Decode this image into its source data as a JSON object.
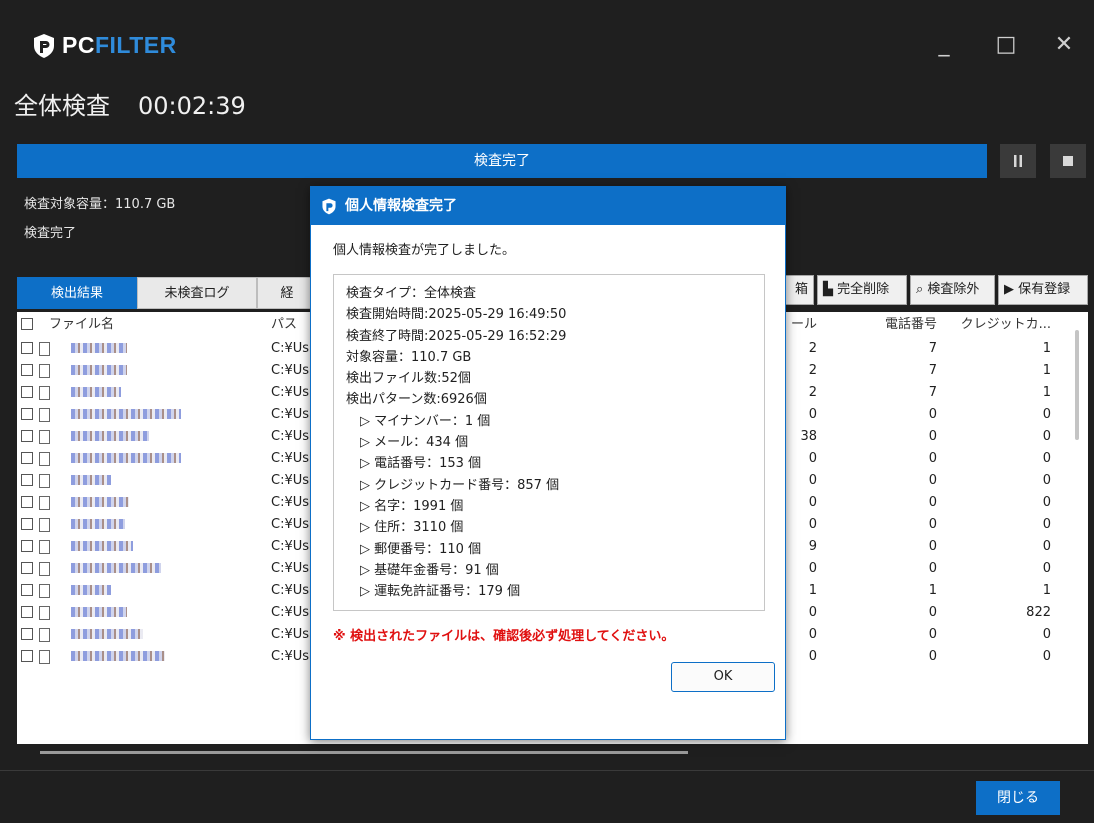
{
  "app": {
    "logo_pc": "PC",
    "logo_filter": "FILTER",
    "window_controls": {
      "minimize": "_",
      "maximize": "□",
      "close": "✕"
    }
  },
  "page": {
    "title": "全体検査",
    "elapsed": "00:02:39"
  },
  "progress": {
    "label": "検査完了",
    "percent": 100,
    "pause_icon": "pause-icon",
    "stop_icon": "stop-icon"
  },
  "info": {
    "capacity": "検査対象容量：110.7 GB",
    "status": "検査完了"
  },
  "tabs": [
    {
      "label": "検出結果",
      "active": true
    },
    {
      "label": "未検査ログ",
      "active": false
    },
    {
      "label": "経",
      "active": false
    }
  ],
  "toolbar": {
    "partial_label": "箱",
    "delete_label": "完全削除",
    "exclude_label": "検査除外",
    "register_label": "保有登録"
  },
  "table": {
    "headers": {
      "name": "ファイル名",
      "path": "パス",
      "mail": "ール",
      "phone": "電話番号",
      "credit": "クレジットカ..."
    },
    "rows": [
      {
        "path": "C:¥Us",
        "mail": "2",
        "phone": "7",
        "credit": "1"
      },
      {
        "path": "C:¥Us",
        "mail": "2",
        "phone": "7",
        "credit": "1"
      },
      {
        "path": "C:¥Us",
        "mail": "2",
        "phone": "7",
        "credit": "1"
      },
      {
        "path": "C:¥Us",
        "mail": "0",
        "phone": "0",
        "credit": "0"
      },
      {
        "path": "C:¥Us",
        "mail": "38",
        "phone": "0",
        "credit": "0"
      },
      {
        "path": "C:¥Us",
        "mail": "0",
        "phone": "0",
        "credit": "0"
      },
      {
        "path": "C:¥Us",
        "mail": "0",
        "phone": "0",
        "credit": "0"
      },
      {
        "path": "C:¥Us",
        "mail": "0",
        "phone": "0",
        "credit": "0"
      },
      {
        "path": "C:¥Us",
        "mail": "0",
        "phone": "0",
        "credit": "0"
      },
      {
        "path": "C:¥Us",
        "mail": "9",
        "phone": "0",
        "credit": "0"
      },
      {
        "path": "C:¥Us",
        "mail": "0",
        "phone": "0",
        "credit": "0"
      },
      {
        "path": "C:¥Us",
        "mail": "1",
        "phone": "1",
        "credit": "1"
      },
      {
        "path": "C:¥Us",
        "mail": "0",
        "phone": "0",
        "credit": "822"
      },
      {
        "path": "C:¥Us",
        "mail": "0",
        "phone": "0",
        "credit": "0"
      },
      {
        "path": "C:¥Us",
        "mail": "0",
        "phone": "0",
        "credit": "0"
      }
    ]
  },
  "footer": {
    "close_label": "閉じる"
  },
  "dialog": {
    "title": "個人情報検査完了",
    "message": "個人情報検査が完了しました。",
    "summary": [
      "検査タイプ：全体検査",
      "検査開始時間:2025-05-29 16:49:50",
      "検査終了時間:2025-05-29 16:52:29",
      "対象容量：110.7 GB",
      "検出ファイル数:52個",
      "検出パターン数:6926個"
    ],
    "patterns": [
      "▷ マイナンバー：1 個",
      "▷ メール：434 個",
      "▷ 電話番号：153 個",
      "▷ クレジットカード番号：857 個",
      "▷ 名字：1991 個",
      "▷ 住所：3110 個",
      "▷ 郵便番号：110 個",
      "▷ 基礎年金番号：91 個",
      "▷ 運転免許証番号：179 個"
    ],
    "warning": "※ 検出されたファイルは、確認後必ず処理してください。",
    "ok_label": "OK"
  }
}
